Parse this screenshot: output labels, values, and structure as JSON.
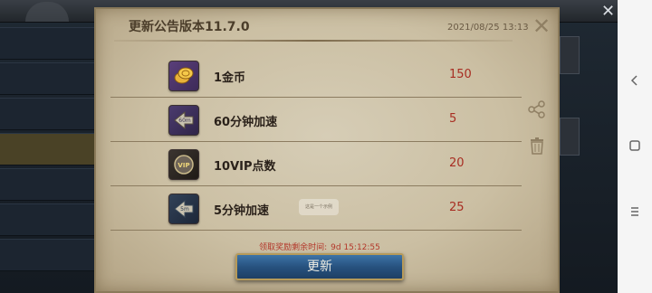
{
  "dialog": {
    "title": "更新公告版本11.7.0",
    "date": "2021/08/25 13:13",
    "close_icon": "close-icon",
    "countdown_label": "领取奖励剩余时间:",
    "countdown_value": "9d 15:12:55",
    "update_label": "更新",
    "watermark": "这是一个示例"
  },
  "rewards": [
    {
      "name": "1金币",
      "qty": "150",
      "icon": "gold-coin-icon"
    },
    {
      "name": "60分钟加速",
      "qty": "5",
      "icon": "speedup-60-icon"
    },
    {
      "name": "10VIP点数",
      "qty": "20",
      "icon": "vip-points-icon"
    },
    {
      "name": "5分钟加速",
      "qty": "25",
      "icon": "speedup-5-icon"
    }
  ],
  "side_tools": [
    "share-icon",
    "trash-icon"
  ],
  "background_menu": [
    "",
    "",
    "",
    "",
    "",
    "",
    "",
    ""
  ],
  "nav": [
    "back-icon",
    "home-icon",
    "menu-icon"
  ],
  "colors": {
    "parchment": "#cbbfa3",
    "quantity": "#a82d22",
    "countdown": "#b3372a",
    "button": "#27527f"
  }
}
